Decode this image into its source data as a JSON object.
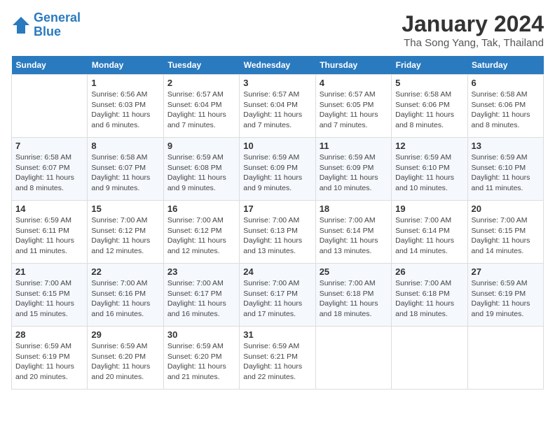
{
  "logo": {
    "text_general": "General",
    "text_blue": "Blue"
  },
  "title": "January 2024",
  "subtitle": "Tha Song Yang, Tak, Thailand",
  "days_of_week": [
    "Sunday",
    "Monday",
    "Tuesday",
    "Wednesday",
    "Thursday",
    "Friday",
    "Saturday"
  ],
  "weeks": [
    [
      {
        "num": "",
        "sunrise": "",
        "sunset": "",
        "daylight": ""
      },
      {
        "num": "1",
        "sunrise": "Sunrise: 6:56 AM",
        "sunset": "Sunset: 6:03 PM",
        "daylight": "Daylight: 11 hours and 6 minutes."
      },
      {
        "num": "2",
        "sunrise": "Sunrise: 6:57 AM",
        "sunset": "Sunset: 6:04 PM",
        "daylight": "Daylight: 11 hours and 7 minutes."
      },
      {
        "num": "3",
        "sunrise": "Sunrise: 6:57 AM",
        "sunset": "Sunset: 6:04 PM",
        "daylight": "Daylight: 11 hours and 7 minutes."
      },
      {
        "num": "4",
        "sunrise": "Sunrise: 6:57 AM",
        "sunset": "Sunset: 6:05 PM",
        "daylight": "Daylight: 11 hours and 7 minutes."
      },
      {
        "num": "5",
        "sunrise": "Sunrise: 6:58 AM",
        "sunset": "Sunset: 6:06 PM",
        "daylight": "Daylight: 11 hours and 8 minutes."
      },
      {
        "num": "6",
        "sunrise": "Sunrise: 6:58 AM",
        "sunset": "Sunset: 6:06 PM",
        "daylight": "Daylight: 11 hours and 8 minutes."
      }
    ],
    [
      {
        "num": "7",
        "sunrise": "Sunrise: 6:58 AM",
        "sunset": "Sunset: 6:07 PM",
        "daylight": "Daylight: 11 hours and 8 minutes."
      },
      {
        "num": "8",
        "sunrise": "Sunrise: 6:58 AM",
        "sunset": "Sunset: 6:07 PM",
        "daylight": "Daylight: 11 hours and 9 minutes."
      },
      {
        "num": "9",
        "sunrise": "Sunrise: 6:59 AM",
        "sunset": "Sunset: 6:08 PM",
        "daylight": "Daylight: 11 hours and 9 minutes."
      },
      {
        "num": "10",
        "sunrise": "Sunrise: 6:59 AM",
        "sunset": "Sunset: 6:09 PM",
        "daylight": "Daylight: 11 hours and 9 minutes."
      },
      {
        "num": "11",
        "sunrise": "Sunrise: 6:59 AM",
        "sunset": "Sunset: 6:09 PM",
        "daylight": "Daylight: 11 hours and 10 minutes."
      },
      {
        "num": "12",
        "sunrise": "Sunrise: 6:59 AM",
        "sunset": "Sunset: 6:10 PM",
        "daylight": "Daylight: 11 hours and 10 minutes."
      },
      {
        "num": "13",
        "sunrise": "Sunrise: 6:59 AM",
        "sunset": "Sunset: 6:10 PM",
        "daylight": "Daylight: 11 hours and 11 minutes."
      }
    ],
    [
      {
        "num": "14",
        "sunrise": "Sunrise: 6:59 AM",
        "sunset": "Sunset: 6:11 PM",
        "daylight": "Daylight: 11 hours and 11 minutes."
      },
      {
        "num": "15",
        "sunrise": "Sunrise: 7:00 AM",
        "sunset": "Sunset: 6:12 PM",
        "daylight": "Daylight: 11 hours and 12 minutes."
      },
      {
        "num": "16",
        "sunrise": "Sunrise: 7:00 AM",
        "sunset": "Sunset: 6:12 PM",
        "daylight": "Daylight: 11 hours and 12 minutes."
      },
      {
        "num": "17",
        "sunrise": "Sunrise: 7:00 AM",
        "sunset": "Sunset: 6:13 PM",
        "daylight": "Daylight: 11 hours and 13 minutes."
      },
      {
        "num": "18",
        "sunrise": "Sunrise: 7:00 AM",
        "sunset": "Sunset: 6:14 PM",
        "daylight": "Daylight: 11 hours and 13 minutes."
      },
      {
        "num": "19",
        "sunrise": "Sunrise: 7:00 AM",
        "sunset": "Sunset: 6:14 PM",
        "daylight": "Daylight: 11 hours and 14 minutes."
      },
      {
        "num": "20",
        "sunrise": "Sunrise: 7:00 AM",
        "sunset": "Sunset: 6:15 PM",
        "daylight": "Daylight: 11 hours and 14 minutes."
      }
    ],
    [
      {
        "num": "21",
        "sunrise": "Sunrise: 7:00 AM",
        "sunset": "Sunset: 6:15 PM",
        "daylight": "Daylight: 11 hours and 15 minutes."
      },
      {
        "num": "22",
        "sunrise": "Sunrise: 7:00 AM",
        "sunset": "Sunset: 6:16 PM",
        "daylight": "Daylight: 11 hours and 16 minutes."
      },
      {
        "num": "23",
        "sunrise": "Sunrise: 7:00 AM",
        "sunset": "Sunset: 6:17 PM",
        "daylight": "Daylight: 11 hours and 16 minutes."
      },
      {
        "num": "24",
        "sunrise": "Sunrise: 7:00 AM",
        "sunset": "Sunset: 6:17 PM",
        "daylight": "Daylight: 11 hours and 17 minutes."
      },
      {
        "num": "25",
        "sunrise": "Sunrise: 7:00 AM",
        "sunset": "Sunset: 6:18 PM",
        "daylight": "Daylight: 11 hours and 18 minutes."
      },
      {
        "num": "26",
        "sunrise": "Sunrise: 7:00 AM",
        "sunset": "Sunset: 6:18 PM",
        "daylight": "Daylight: 11 hours and 18 minutes."
      },
      {
        "num": "27",
        "sunrise": "Sunrise: 6:59 AM",
        "sunset": "Sunset: 6:19 PM",
        "daylight": "Daylight: 11 hours and 19 minutes."
      }
    ],
    [
      {
        "num": "28",
        "sunrise": "Sunrise: 6:59 AM",
        "sunset": "Sunset: 6:19 PM",
        "daylight": "Daylight: 11 hours and 20 minutes."
      },
      {
        "num": "29",
        "sunrise": "Sunrise: 6:59 AM",
        "sunset": "Sunset: 6:20 PM",
        "daylight": "Daylight: 11 hours and 20 minutes."
      },
      {
        "num": "30",
        "sunrise": "Sunrise: 6:59 AM",
        "sunset": "Sunset: 6:20 PM",
        "daylight": "Daylight: 11 hours and 21 minutes."
      },
      {
        "num": "31",
        "sunrise": "Sunrise: 6:59 AM",
        "sunset": "Sunset: 6:21 PM",
        "daylight": "Daylight: 11 hours and 22 minutes."
      },
      {
        "num": "",
        "sunrise": "",
        "sunset": "",
        "daylight": ""
      },
      {
        "num": "",
        "sunrise": "",
        "sunset": "",
        "daylight": ""
      },
      {
        "num": "",
        "sunrise": "",
        "sunset": "",
        "daylight": ""
      }
    ]
  ]
}
